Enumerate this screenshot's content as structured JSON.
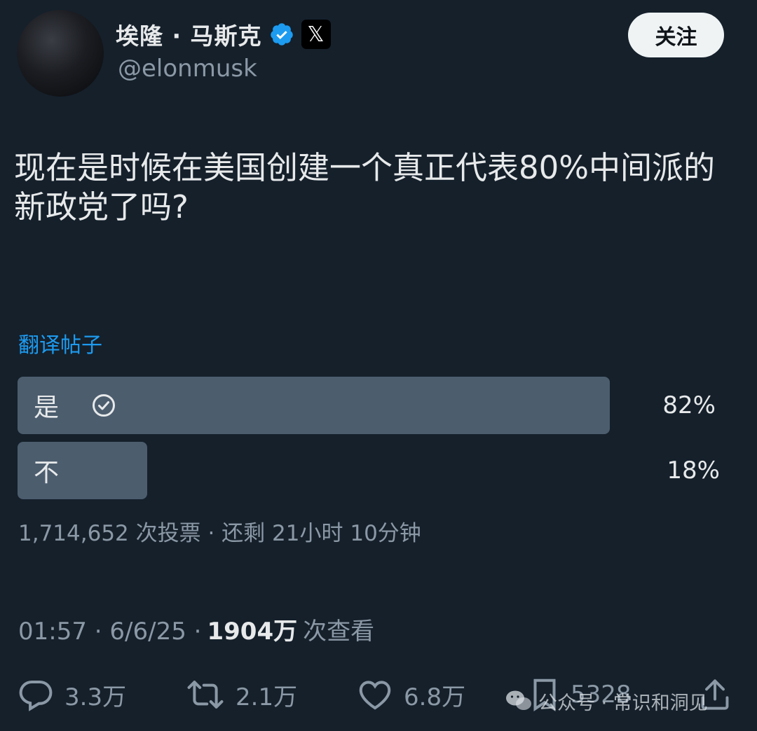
{
  "author": {
    "display_name": "埃隆 · 马斯克",
    "handle": "@elonmusk",
    "verified": true,
    "badge_icon": "x-logo-icon",
    "follow_label": "关注"
  },
  "post": {
    "text": "现在是时候在美国创建一个真正代表80%中间派的新政党了吗?",
    "translate_label": "翻译帖子"
  },
  "poll": {
    "options": [
      {
        "label": "是",
        "percent_label": "82%",
        "percent": 82,
        "selected": true
      },
      {
        "label": "不",
        "percent_label": "18%",
        "percent": 18,
        "selected": false
      }
    ],
    "meta": "1,714,652 次投票 · 还剩 21小时 10分钟"
  },
  "timestamp": {
    "time_date": "01:57 · 6/6/25 ·",
    "views": "1904万",
    "views_suffix": "次查看"
  },
  "actions": {
    "reply_count": "3.3万",
    "retweet_count": "2.1万",
    "like_count": "6.8万",
    "bookmark_count": "5328"
  },
  "watermark": {
    "text": "公众号 · 常识和洞见"
  },
  "colors": {
    "background": "#15202b",
    "poll_bar": "#4c5d6e",
    "link": "#1d9bf0",
    "verified": "#1d9bf0",
    "muted_text": "#8b98a5"
  }
}
